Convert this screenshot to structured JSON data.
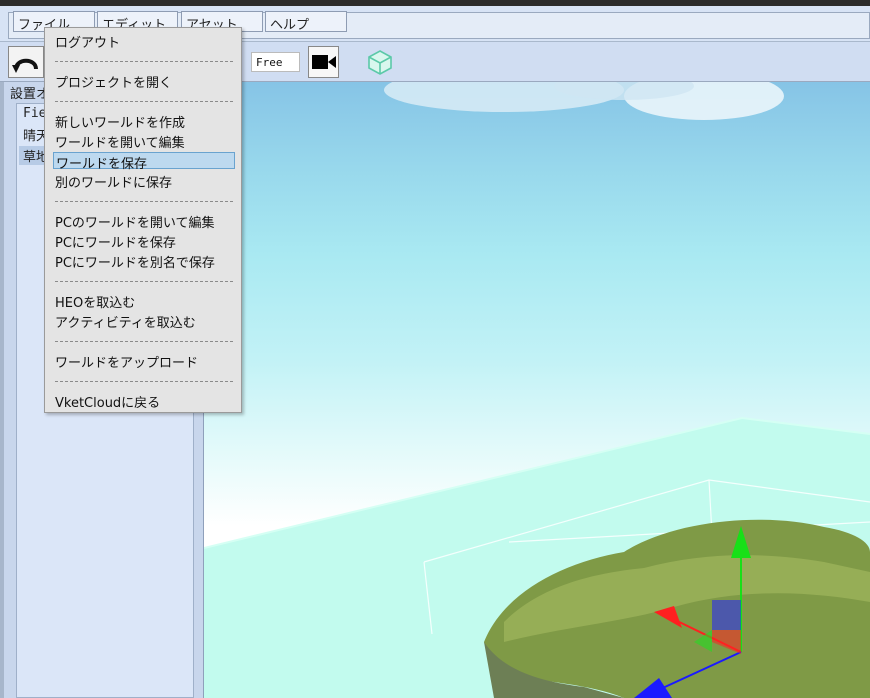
{
  "menubar": {
    "items": [
      "ファイル",
      "エディット",
      "アセット",
      "ヘルプ"
    ]
  },
  "toolbar": {
    "undo_icon": "undo-arrow-icon",
    "camera_mode": "Free",
    "camera_icon": "video-camera-icon",
    "cube_icon": "cube-icon"
  },
  "left_panel": {
    "title": "設置オブジェクト",
    "items": [
      "Field",
      "晴天",
      "草地"
    ]
  },
  "file_menu": {
    "logout": "ログアウト",
    "open_project": "プロジェクトを開く",
    "new_world": "新しいワールドを作成",
    "open_edit_world": "ワールドを開いて編集",
    "save_world": "ワールドを保存",
    "save_as_world": "別のワールドに保存",
    "pc_open_edit": "PCのワールドを開いて編集",
    "pc_save": "PCにワールドを保存",
    "pc_save_as": "PCにワールドを別名で保存",
    "import_heo": "HEOを取込む",
    "import_activity": "アクティビティを取込む",
    "upload_world": "ワールドをアップロード",
    "back_to_vket": "VketCloudに戻る"
  },
  "colors": {
    "highlight": "#bdd9ef",
    "gizmo_x": "#ff2020",
    "gizmo_y": "#18e018",
    "gizmo_z": "#1a1aff"
  }
}
